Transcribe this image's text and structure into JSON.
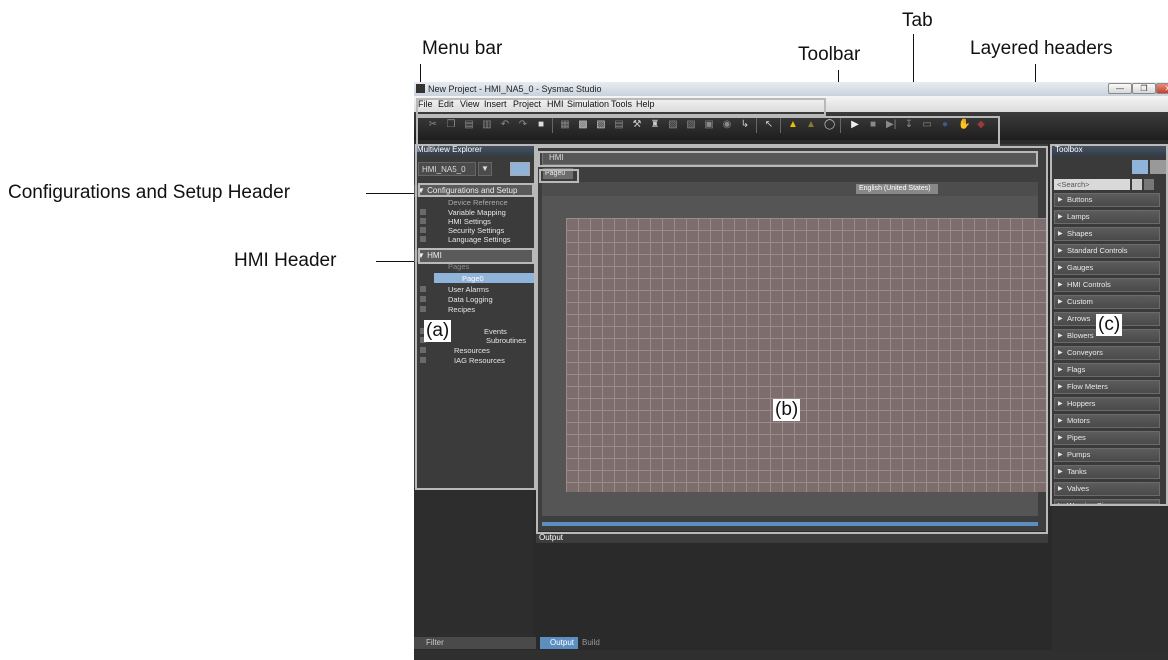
{
  "callouts": {
    "menu_bar": "Menu bar",
    "toolbar": "Toolbar",
    "tab": "Tab",
    "layered_headers": "Layered headers",
    "config_header": "Configurations and Setup Header",
    "hmi_header": "HMI Header"
  },
  "window": {
    "title": "New Project - HMI_NA5_0 - Sysmac Studio",
    "minimize": "—",
    "maximize": "❐",
    "close": "✕"
  },
  "menu": [
    "File",
    "Edit",
    "View",
    "Insert",
    "Project",
    "HMI",
    "Simulation",
    "Tools",
    "Help"
  ],
  "left_panel": {
    "title": "Multiview Explorer",
    "device": "HMI_NA5_0",
    "config_header": "▼ Configurations and Setup",
    "config_items": [
      "Device Reference",
      "Variable Mapping",
      "HMI Settings",
      "Security Settings",
      "Language Settings"
    ],
    "hmi_header": "▼ HMI",
    "hmi_items": [
      "Pages",
      "Page0",
      "User Alarms",
      "Data Logging",
      "Recipes",
      "Events",
      "Subroutines",
      "Resources",
      "IAG Resources"
    ],
    "filter": "Filter",
    "label": "(a)"
  },
  "center": {
    "editor_header": "HMI",
    "tab_label": "Page0",
    "language": "English (United States)",
    "label": "(b)",
    "output_title": "Output",
    "output_tab": "Output",
    "build_tab": "Build"
  },
  "toolbox": {
    "title": "Toolbox",
    "search_placeholder": "<Search>",
    "categories": [
      "Buttons",
      "Lamps",
      "Shapes",
      "Standard Controls",
      "Gauges",
      "HMI Controls",
      "Custom",
      "Arrows",
      "Blowers",
      "Conveyors",
      "Flags",
      "Flow Meters",
      "Hoppers",
      "Motors",
      "Pipes",
      "Pumps",
      "Tanks",
      "Valves",
      "Warning Signs"
    ],
    "label": "(c)"
  },
  "colors": {
    "titlebar": "#d8dfe7",
    "dark_panel": "#3b3b3b",
    "canvas": "#7d6d6d",
    "accent": "#5b8fc2",
    "warning": "#e6c200"
  }
}
